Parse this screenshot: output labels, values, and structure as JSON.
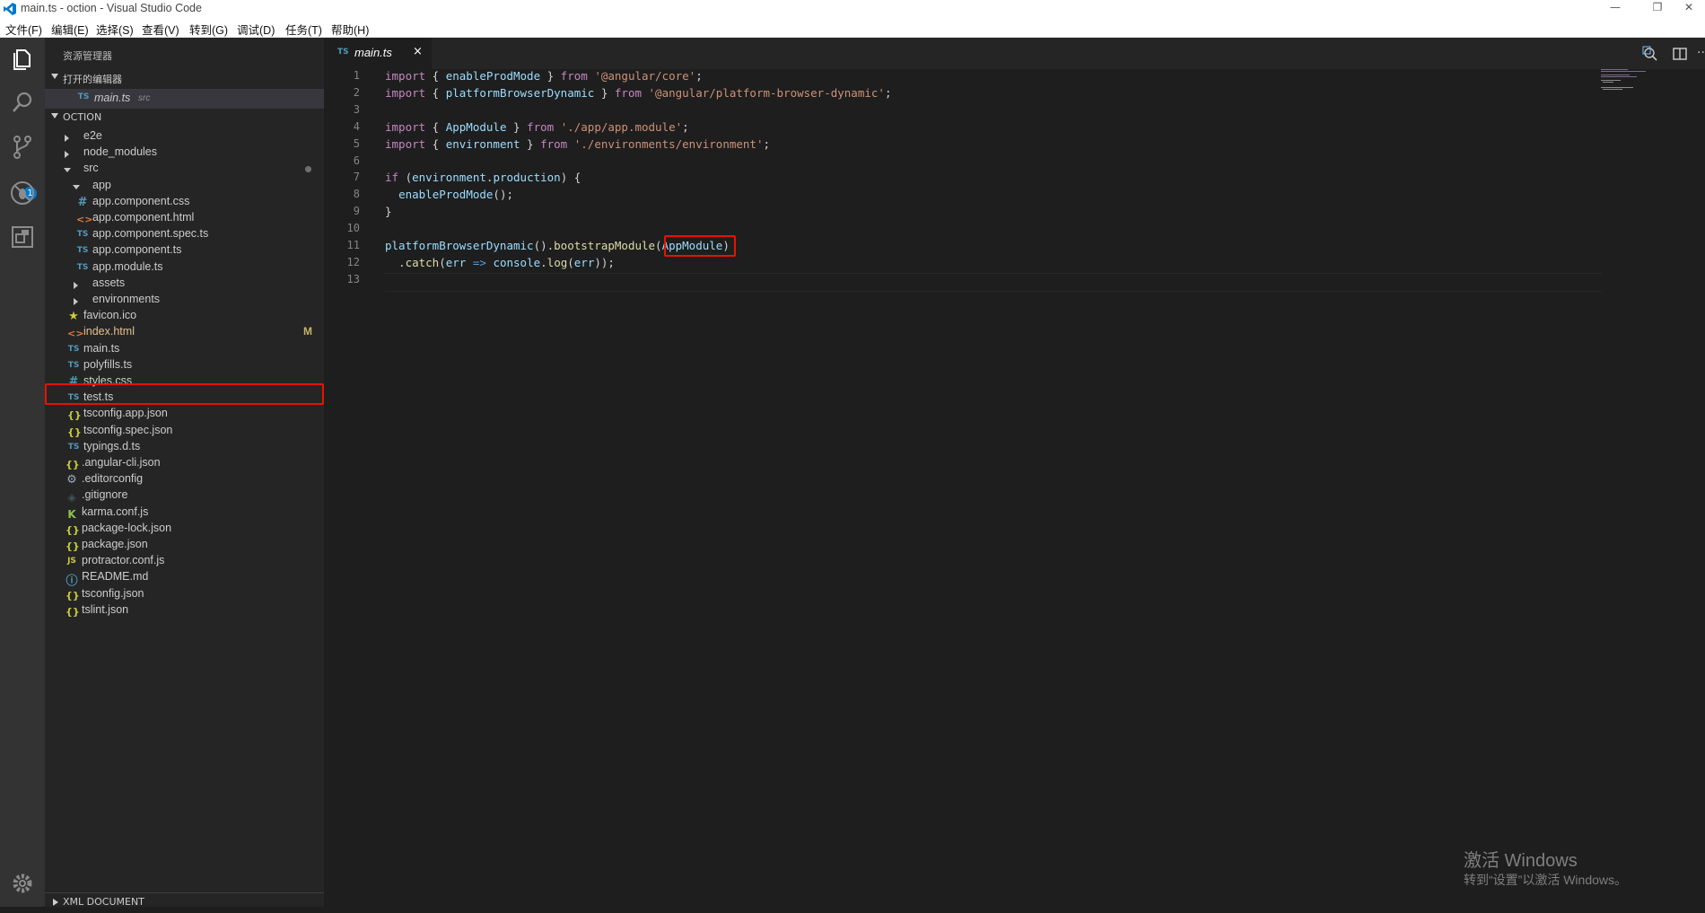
{
  "window": {
    "title": "main.ts - oction - Visual Studio Code"
  },
  "menu": [
    "文件(F)",
    "编辑(E)",
    "选择(S)",
    "查看(V)",
    "转到(G)",
    "调试(D)",
    "任务(T)",
    "帮助(H)"
  ],
  "activity": {
    "scm_badge": "1"
  },
  "sidebar": {
    "title": "资源管理器",
    "open_editors_title": "打开的编辑器",
    "open_editor": {
      "icon": "TS",
      "name": "main.ts",
      "folder": "src"
    },
    "project_title": "OCTION",
    "footer_section": "XML DOCUMENT",
    "tree": [
      {
        "label": "e2e",
        "type": "folder-closed",
        "icon": ""
      },
      {
        "label": "node_modules",
        "type": "folder-closed",
        "icon": ""
      },
      {
        "label": "src",
        "type": "folder-open",
        "icon": ""
      },
      {
        "label": "app",
        "type": "folder-open",
        "icon": ""
      },
      {
        "label": "app.component.css",
        "type": "file",
        "icon": "#"
      },
      {
        "label": "app.component.html",
        "type": "file",
        "icon": "<>"
      },
      {
        "label": "app.component.spec.ts",
        "type": "file",
        "icon": "TS"
      },
      {
        "label": "app.component.ts",
        "type": "file",
        "icon": "TS"
      },
      {
        "label": "app.module.ts",
        "type": "file",
        "icon": "TS"
      },
      {
        "label": "assets",
        "type": "folder-closed",
        "icon": ""
      },
      {
        "label": "environments",
        "type": "folder-closed",
        "icon": ""
      },
      {
        "label": "favicon.ico",
        "type": "file",
        "icon": "★"
      },
      {
        "label": "index.html",
        "type": "file",
        "icon": "<>",
        "status": "M"
      },
      {
        "label": "main.ts",
        "type": "file",
        "icon": "TS"
      },
      {
        "label": "polyfills.ts",
        "type": "file",
        "icon": "TS"
      },
      {
        "label": "styles.css",
        "type": "file",
        "icon": "#"
      },
      {
        "label": "test.ts",
        "type": "file",
        "icon": "TS"
      },
      {
        "label": "tsconfig.app.json",
        "type": "file",
        "icon": "{}"
      },
      {
        "label": "tsconfig.spec.json",
        "type": "file",
        "icon": "{}"
      },
      {
        "label": "typings.d.ts",
        "type": "file",
        "icon": "TS"
      },
      {
        "label": ".angular-cli.json",
        "type": "file",
        "icon": "{}"
      },
      {
        "label": ".editorconfig",
        "type": "file",
        "icon": "⚙"
      },
      {
        "label": ".gitignore",
        "type": "file",
        "icon": "◈"
      },
      {
        "label": "karma.conf.js",
        "type": "file",
        "icon": "K"
      },
      {
        "label": "package-lock.json",
        "type": "file",
        "icon": "{}"
      },
      {
        "label": "package.json",
        "type": "file",
        "icon": "{}"
      },
      {
        "label": "protractor.conf.js",
        "type": "file",
        "icon": "JS"
      },
      {
        "label": "README.md",
        "type": "file",
        "icon": "ⓘ"
      },
      {
        "label": "tsconfig.json",
        "type": "file",
        "icon": "{}"
      },
      {
        "label": "tslint.json",
        "type": "file",
        "icon": "{}"
      }
    ]
  },
  "tab": {
    "icon": "TS",
    "name": "main.ts",
    "close": "×"
  },
  "editor": {
    "line_numbers": [
      "1",
      "2",
      "3",
      "4",
      "5",
      "6",
      "7",
      "8",
      "9",
      "10",
      "11",
      "12",
      "13"
    ],
    "lines": [
      "import { enableProdMode } from '@angular/core';",
      "import { platformBrowserDynamic } from '@angular/platform-browser-dynamic';",
      "",
      "import { AppModule } from './app/app.module';",
      "import { environment } from './environments/environment';",
      "",
      "if (environment.production) {",
      "  enableProdMode();",
      "}",
      "",
      "platformBrowserDynamic().bootstrapModule(AppModule)",
      "  .catch(err => console.log(err));",
      ""
    ]
  },
  "watermark": {
    "line1": "激活 Windows",
    "line2": "转到“设置”以激活 Windows。"
  }
}
